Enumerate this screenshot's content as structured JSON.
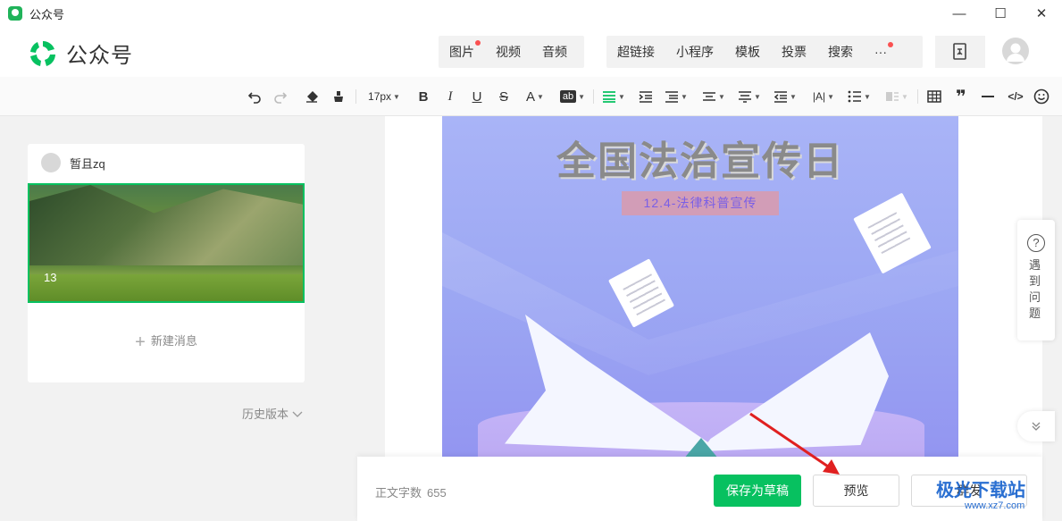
{
  "window": {
    "title": "公众号",
    "minimize": "—",
    "maximize": "☐",
    "close": "✕"
  },
  "header": {
    "logo_text": "公众号",
    "media": [
      {
        "label": "图片",
        "dot": true
      },
      {
        "label": "视频",
        "dot": false
      },
      {
        "label": "音频",
        "dot": false
      }
    ],
    "links": [
      {
        "label": "超链接",
        "dot": false
      },
      {
        "label": "小程序",
        "dot": false
      },
      {
        "label": "模板",
        "dot": false
      },
      {
        "label": "投票",
        "dot": false
      },
      {
        "label": "搜索",
        "dot": false
      },
      {
        "label": "···",
        "dot": true
      }
    ]
  },
  "toolbar": {
    "font_size": "17px",
    "bold": "B",
    "italic": "I",
    "underline": "U",
    "strike": "S",
    "font_color": "A",
    "bg_color": "ab",
    "letter_spacing": "|A|",
    "quote": "❞",
    "code": "</>"
  },
  "left": {
    "author": "暂且zq",
    "cover_count": "13",
    "new_message": "新建消息",
    "history": "历史版本"
  },
  "poster": {
    "title": "全国法治宣传日",
    "subtitle": "12.4-法律科普宣传"
  },
  "side_help": {
    "icon": "?",
    "text": "遇到问题"
  },
  "bottom": {
    "wordcount_label": "正文字数",
    "wordcount_value": "655",
    "save": "保存为草稿",
    "preview": "预览",
    "publish": "群发"
  },
  "watermark": {
    "text": "极光下载站",
    "url": "www.xz7.com"
  },
  "colors": {
    "accent": "#07c160",
    "dot": "#fa5151",
    "poster_bg": "#9ca7f3"
  }
}
